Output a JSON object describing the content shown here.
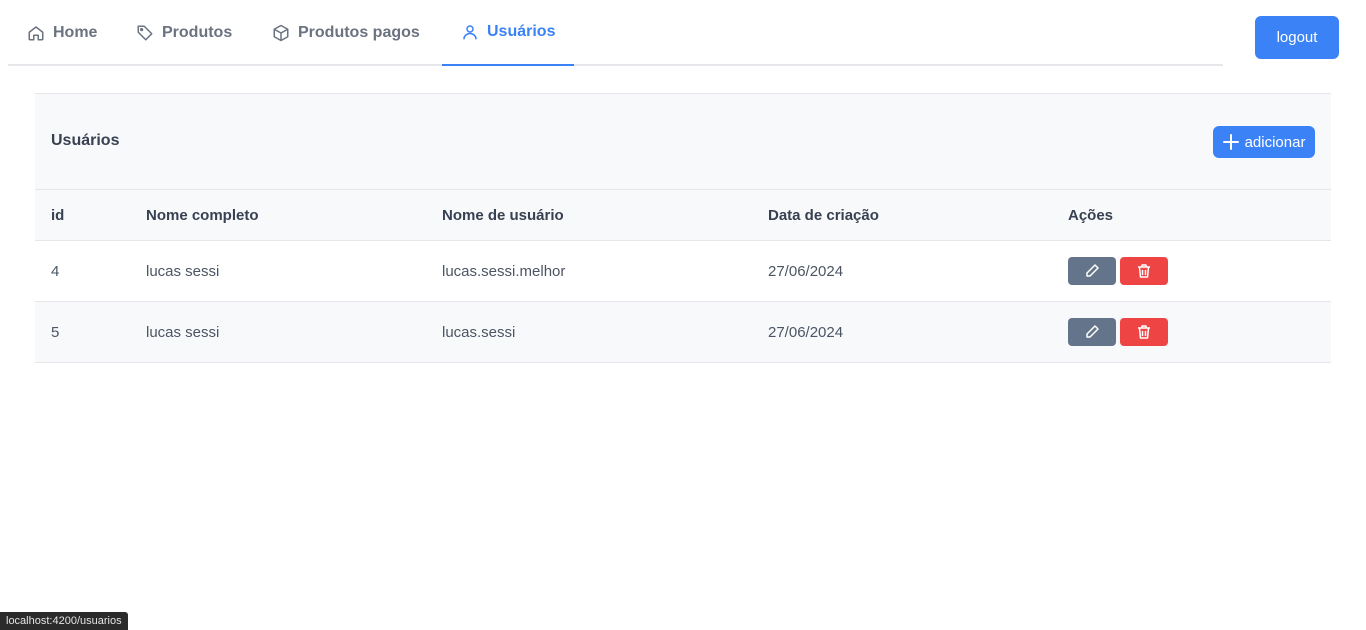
{
  "nav": {
    "tabs": [
      {
        "label": "Home",
        "icon": "home-icon"
      },
      {
        "label": "Produtos",
        "icon": "tag-icon"
      },
      {
        "label": "Produtos pagos",
        "icon": "box-icon"
      },
      {
        "label": "Usuários",
        "icon": "user-icon",
        "active": true
      }
    ],
    "logout_label": "logout"
  },
  "card": {
    "title": "Usuários",
    "add_label": "adicionar"
  },
  "table": {
    "headers": [
      "id",
      "Nome completo",
      "Nome de usuário",
      "Data de criação",
      "Ações"
    ],
    "rows": [
      {
        "id": "4",
        "nome": "lucas sessi",
        "usuario": "lucas.sessi.melhor",
        "data": "27/06/2024"
      },
      {
        "id": "5",
        "nome": "lucas sessi",
        "usuario": "lucas.sessi",
        "data": "27/06/2024"
      }
    ]
  },
  "statusbar": {
    "url": "localhost:4200/usuarios"
  },
  "colors": {
    "accent": "#3b82f6",
    "danger": "#ef4444",
    "secondary": "#64748b"
  }
}
